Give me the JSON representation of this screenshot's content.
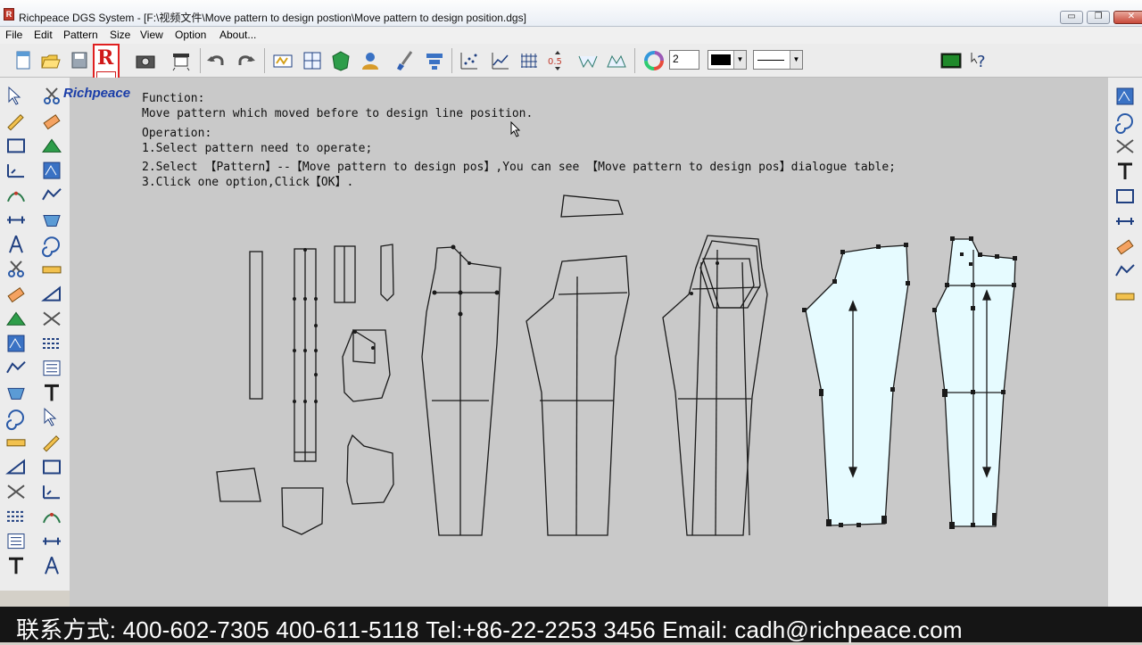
{
  "window": {
    "title": "Richpeace DGS System - [F:\\视频文件\\Move pattern to design postion\\Move pattern to design position.dgs]",
    "controls": {
      "minimize": "▭",
      "restore": "❐",
      "close": "✕"
    }
  },
  "menu": [
    {
      "label": "File"
    },
    {
      "label": "Edit"
    },
    {
      "label": "Pattern"
    },
    {
      "label": "Size"
    },
    {
      "label": "View"
    },
    {
      "label": "Option"
    },
    {
      "label": "About..."
    }
  ],
  "toolbar": {
    "line_width_value": "2",
    "color_value": "black",
    "line_style_value": "solid",
    "step_label": "0.5"
  },
  "brand": {
    "logo_text": "Richpeace"
  },
  "instructions": {
    "function_heading": "Function:",
    "function_text": "Move pattern which moved before to design line position.",
    "operation_heading": "Operation:",
    "step1": "1.Select pattern need to operate;",
    "step2": "2.Select 【Pattern】--【Move pattern to design pos】,You can see 【Move pattern to design pos】dialogue table;",
    "step3": "3.Click one option,Click【OK】."
  },
  "footer": {
    "contact": "联系方式: 400-602-7305  400-611-5118   Tel:+86-22-2253 3456  Email: cadh@richpeace.com"
  },
  "colors": {
    "canvas": "#c9c9c9",
    "selected_fill": "#e6fbff",
    "outline": "#1a1a1a",
    "badge_red": "#e02020"
  },
  "icons": {
    "left": [
      "pointer-icon",
      "pencil-icon",
      "rectangle-icon",
      "ruler-icon",
      "dart-icon",
      "measure-icon",
      "compass-icon",
      "scissors-icon",
      "eraser-icon",
      "notch-icon",
      "piece-icon",
      "grade-icon",
      "fold-icon",
      "spiral-icon",
      "tape-icon",
      "angle-icon",
      "cut-icon",
      "pleat-icon",
      "seam-icon",
      "text-icon"
    ],
    "right": [
      "piece-move-icon",
      "piece-copy-icon",
      "curve-icon",
      "rotate-icon",
      "flip-icon",
      "align-icon",
      "spread-icon",
      "mirror-icon",
      "frame-icon"
    ]
  }
}
